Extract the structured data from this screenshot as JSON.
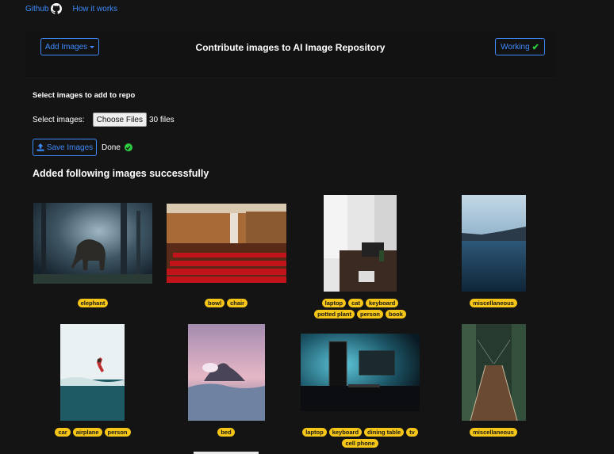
{
  "topnav": {
    "github": "Github",
    "how_it_works": "How it works"
  },
  "navbar": {
    "add_images": "Add Images",
    "title": "Contribute images to AI Image Repository",
    "working": "Working"
  },
  "upload": {
    "section_label": "Select images to add to repo",
    "select_label": "Select images:",
    "choose_button": "Choose Files",
    "file_count": "30 files",
    "save_button": "Save Images",
    "status": "Done"
  },
  "results": {
    "heading": "Added following images successfully",
    "images": [
      {
        "subject": "elephant in forest",
        "tags": [
          "elephant"
        ]
      },
      {
        "subject": "theater seats",
        "tags": [
          "bowl",
          "chair"
        ]
      },
      {
        "subject": "desk with laptop",
        "tags": [
          "laptop",
          "cat",
          "keyboard",
          "potted plant",
          "person",
          "book"
        ]
      },
      {
        "subject": "lake and mountains",
        "tags": [
          "miscellaneous"
        ]
      },
      {
        "subject": "person jumping at beach",
        "tags": [
          "car",
          "airplane",
          "person"
        ]
      },
      {
        "subject": "volcano above clouds",
        "tags": [
          "bed"
        ]
      },
      {
        "subject": "computer setup",
        "tags": [
          "laptop",
          "keyboard",
          "dining table",
          "tv",
          "cell phone"
        ]
      },
      {
        "subject": "suspension bridge in forest",
        "tags": [
          "miscellaneous"
        ]
      }
    ]
  },
  "colors": {
    "background": "#141414",
    "link": "#3d8bfd",
    "tag": "#f5c518",
    "success": "#2ecc40"
  }
}
